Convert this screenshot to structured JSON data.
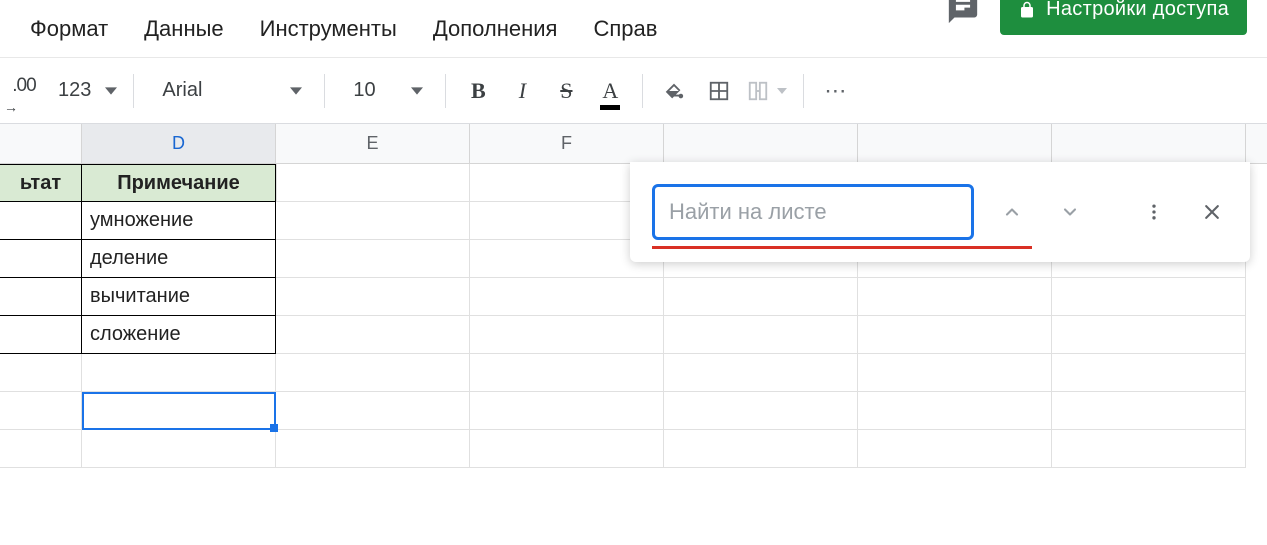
{
  "menu": {
    "format": "Формат",
    "data": "Данные",
    "tools": "Инструменты",
    "addons": "Дополнения",
    "help": "Справ"
  },
  "share": {
    "label": "Настройки доступа"
  },
  "toolbar": {
    "decrease_decimal": ".00",
    "number_format": "123",
    "font_name": "Arial",
    "font_size": "10",
    "bold": "B",
    "italic": "I",
    "strike": "S",
    "text_color": "A",
    "more": "⋯"
  },
  "columns": {
    "C_partial": "",
    "D": "D",
    "E": "E",
    "F": "F"
  },
  "table": {
    "header_c": "ьтат",
    "header_d": "Примечание",
    "rows": [
      {
        "c": "",
        "d": "умножение"
      },
      {
        "c": "",
        "d": "деление"
      },
      {
        "c": "",
        "d": "вычитание"
      },
      {
        "c": "",
        "d": "сложение"
      }
    ]
  },
  "find": {
    "placeholder": "Найти на листе"
  }
}
